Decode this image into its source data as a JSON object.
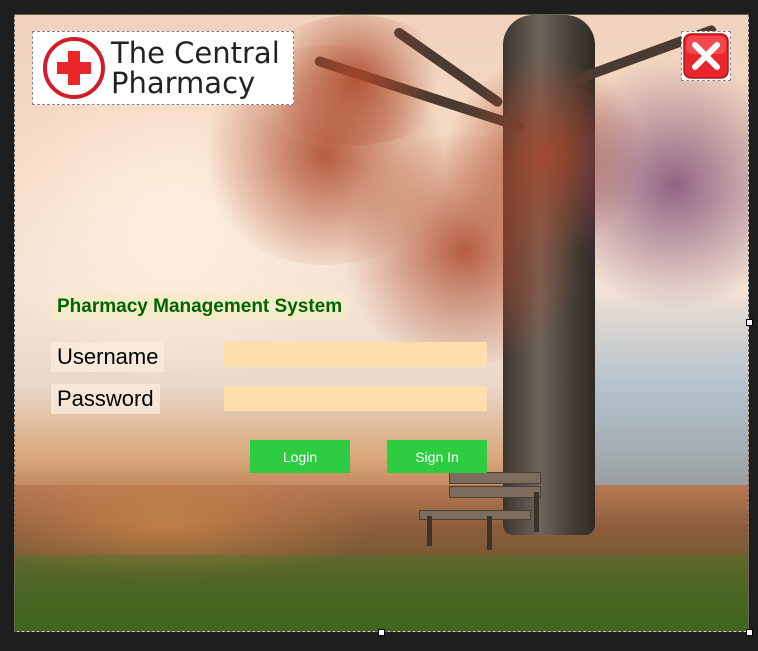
{
  "logo": {
    "line1": "The Central",
    "line2": "Pharmacy"
  },
  "close_button": {
    "icon": "close-icon"
  },
  "title": "Pharmacy Management System",
  "form": {
    "username_label": "Username",
    "password_label": "Password",
    "username_value": "",
    "password_value": ""
  },
  "buttons": {
    "login": "Login",
    "signin": "Sign In"
  },
  "colors": {
    "title": "#006400",
    "input_bg": "#ffdead",
    "button_bg": "#2ecc40",
    "close_red": "#e8262b"
  }
}
